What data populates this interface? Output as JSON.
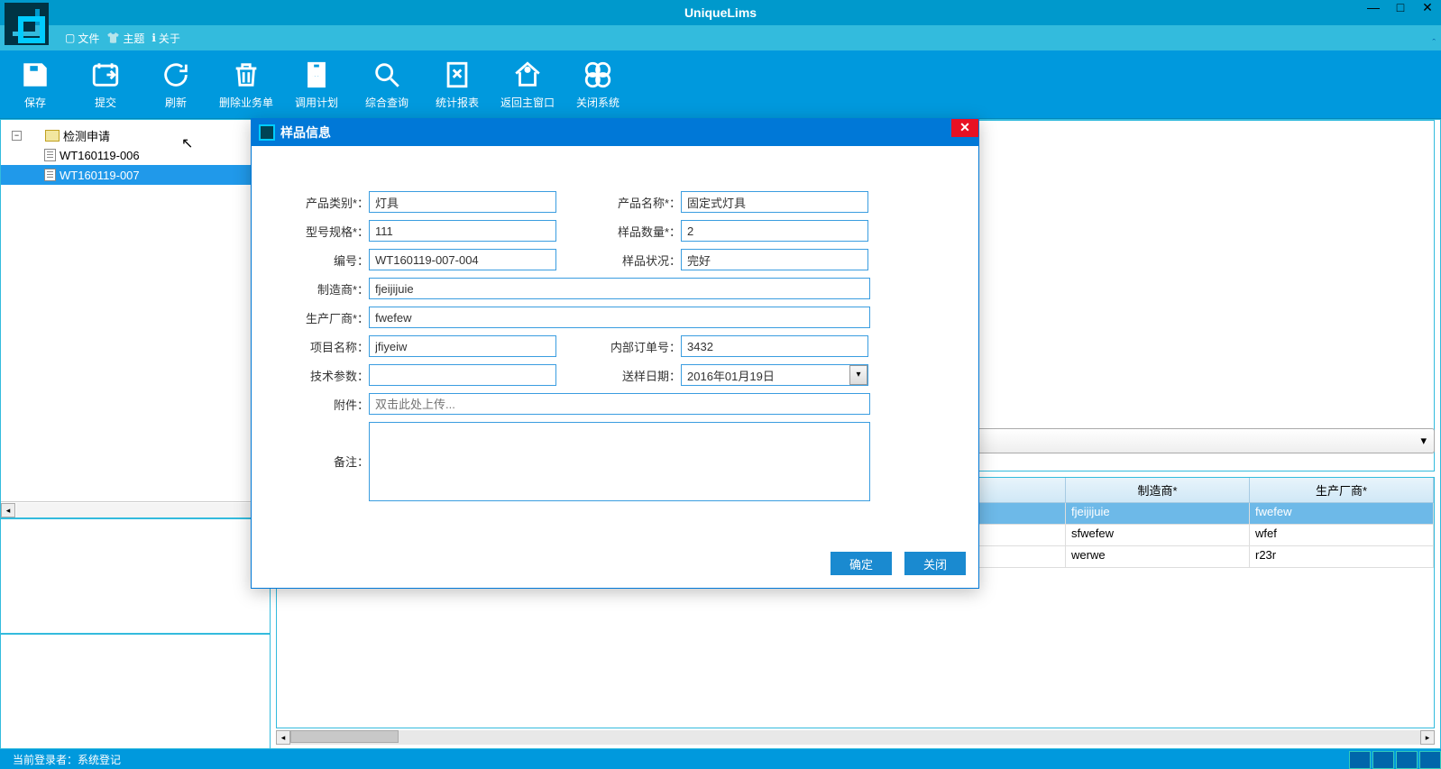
{
  "app_title": "UniqueLims",
  "menus": {
    "file": "文件",
    "theme": "主题",
    "about": "关于"
  },
  "toolbar": {
    "save": "保存",
    "submit": "提交",
    "refresh": "刷新",
    "delete": "删除业务单",
    "plan": "调用计划",
    "query": "综合查询",
    "report": "统计报表",
    "home": "返回主窗口",
    "close": "关闭系统"
  },
  "tree": {
    "root": "检测申请",
    "items": [
      "WT160119-006",
      "WT160119-007"
    ],
    "selected_index": 1
  },
  "grid": {
    "headers": {
      "manufacturer": "制造商*",
      "producer": "生产厂商*"
    },
    "rows": [
      {
        "manufacturer": "fjeijijuie",
        "producer": "fwefew"
      },
      {
        "manufacturer": "sfwefew",
        "producer": "wfef"
      },
      {
        "manufacturer": "werwe",
        "producer": "r23r"
      }
    ],
    "selected_index": 0
  },
  "modal": {
    "title": "样品信息",
    "labels": {
      "category": "产品类别*：",
      "name": "产品名称*：",
      "model": "型号规格*：",
      "qty": "样品数量*：",
      "sn": "编号：",
      "status": "样品状况：",
      "mfr": "制造商*：",
      "prod": "生产厂商*：",
      "proj": "项目名称：",
      "order": "内部订单号：",
      "tech": "技术参数：",
      "date": "送样日期：",
      "attach": "附件：",
      "remark": "备注："
    },
    "values": {
      "category": "灯具",
      "name": "固定式灯具",
      "model": "111",
      "qty": "2",
      "sn": "WT160119-007-004",
      "status": "完好",
      "mfr": "fjeijijuie",
      "prod": "fwefew",
      "proj": "jfiyeiw",
      "order": "3432",
      "tech": "",
      "date": "2016年01月19日",
      "attach_placeholder": "双击此处上传...",
      "remark": ""
    },
    "buttons": {
      "ok": "确定",
      "cancel": "关闭"
    }
  },
  "status_text": "当前登录者：系统登记"
}
